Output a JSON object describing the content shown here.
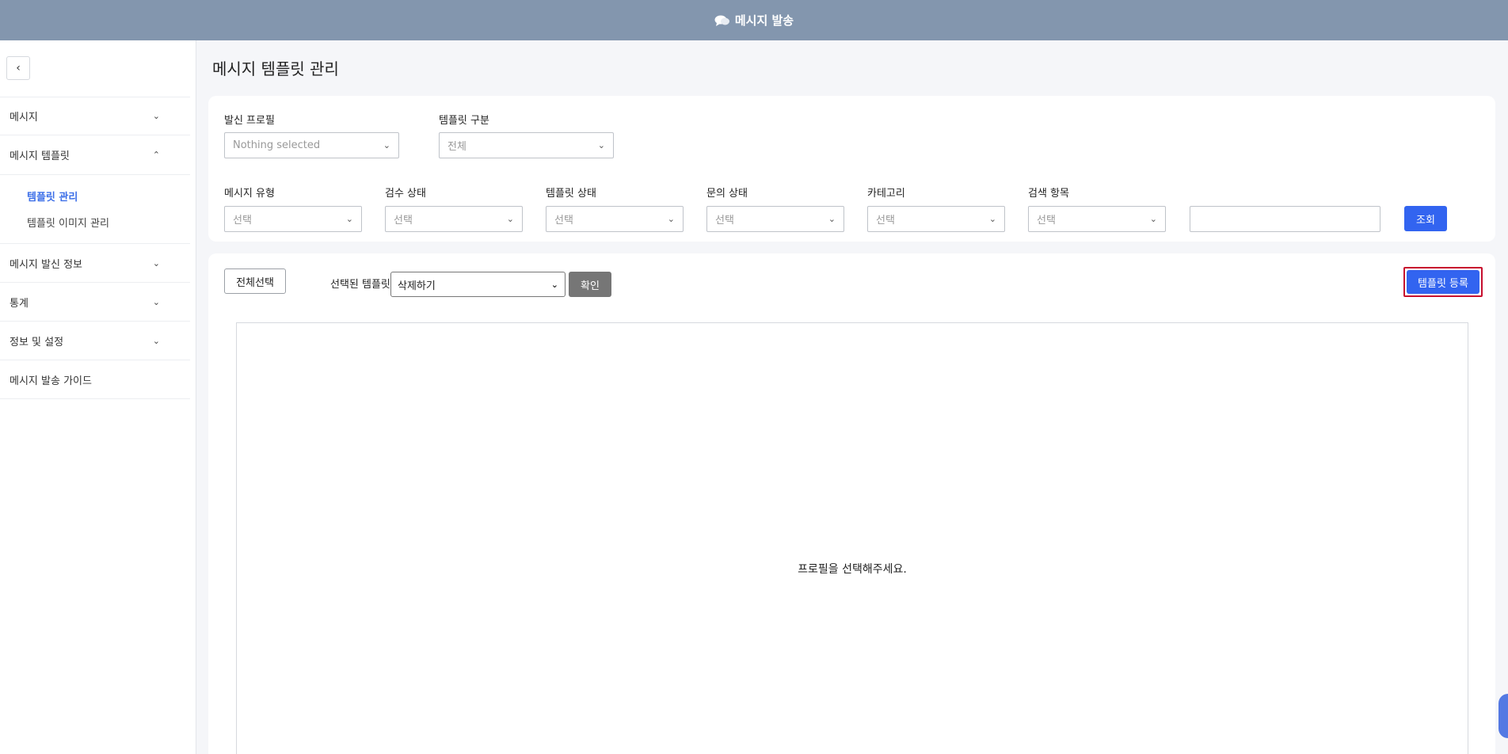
{
  "header": {
    "title": "메시지 발송",
    "icon": "chat-bubbles-icon"
  },
  "sidebar": {
    "collapse_icon": "chevron-left-icon",
    "items": [
      {
        "label": "메시지",
        "expanded": false
      },
      {
        "label": "메시지 템플릿",
        "expanded": true,
        "children": [
          {
            "label": "템플릿 관리",
            "active": true
          },
          {
            "label": "템플릿 이미지 관리",
            "active": false
          }
        ]
      },
      {
        "label": "메시지 발신 정보",
        "expanded": false
      },
      {
        "label": "통계",
        "expanded": false
      },
      {
        "label": "정보 및 설정",
        "expanded": false
      },
      {
        "label": "메시지 발송 가이드"
      }
    ]
  },
  "page": {
    "title": "메시지 템플릿 관리"
  },
  "filters": {
    "sender_profile": {
      "label": "발신 프로필",
      "value": "Nothing selected"
    },
    "template_type": {
      "label": "템플릿 구분",
      "value": "전체"
    },
    "message_type": {
      "label": "메시지 유형",
      "value": "선택"
    },
    "review_status": {
      "label": "검수 상태",
      "value": "선택"
    },
    "template_status": {
      "label": "템플릿 상태",
      "value": "선택"
    },
    "inquiry_status": {
      "label": "문의 상태",
      "value": "선택"
    },
    "category": {
      "label": "카테고리",
      "value": "선택"
    },
    "search_field": {
      "label": "검색 항목",
      "value": "선택"
    },
    "search_text": "",
    "search_button": "조회"
  },
  "list": {
    "select_all": "전체선택",
    "bulk_label": "선택된 템플릿",
    "bulk_action": "삭제하기",
    "confirm": "확인",
    "register": "템플릿 등록",
    "empty_message": "프로필을 선택해주세요."
  },
  "colors": {
    "header": "#8396ae",
    "primary": "#3264f0",
    "active_menu": "#3d6fe8",
    "highlight": "#c8102e"
  }
}
